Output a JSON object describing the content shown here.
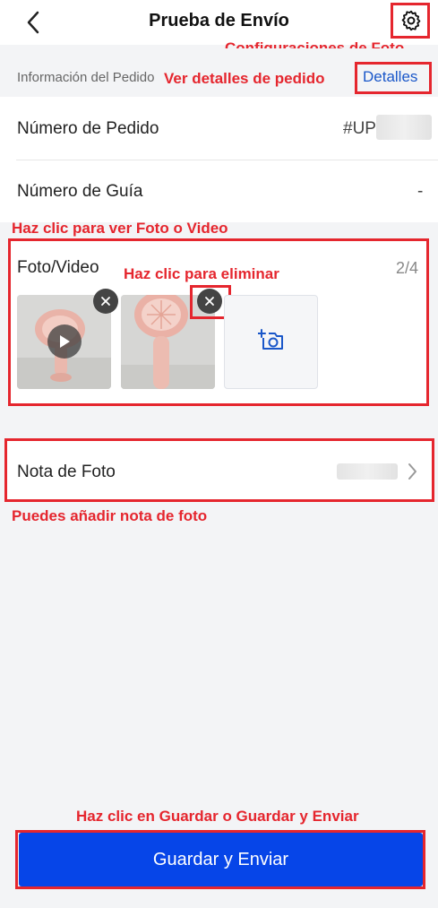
{
  "header": {
    "title": "Prueba de Envío",
    "back_icon": "chevron-left-icon",
    "settings_icon": "gear-icon"
  },
  "order_section": {
    "label": "Información del Pedido",
    "details_link": "Detalles"
  },
  "rows": {
    "order_number": {
      "label": "Número de Pedido",
      "value": "#UP1"
    },
    "guide_number": {
      "label": "Número de Guía",
      "value": "-"
    }
  },
  "photo_section": {
    "title": "Foto/Video",
    "count": "2/4"
  },
  "note_row": {
    "label": "Nota de Foto"
  },
  "save_button": "Guardar y Enviar",
  "annotations": {
    "photo_settings": "Configuraciones de Foto",
    "order_details": "Ver detalles de pedido",
    "view_media": "Haz clic para ver Foto o Video",
    "delete": "Haz clic para eliminar",
    "note_hint": "Puedes añadir nota de foto",
    "save_hint": "Haz clic en Guardar o Guardar y Enviar"
  },
  "colors": {
    "accent": "#1a57c9",
    "primary_button": "#0645e8",
    "annotation": "#e5262e"
  }
}
